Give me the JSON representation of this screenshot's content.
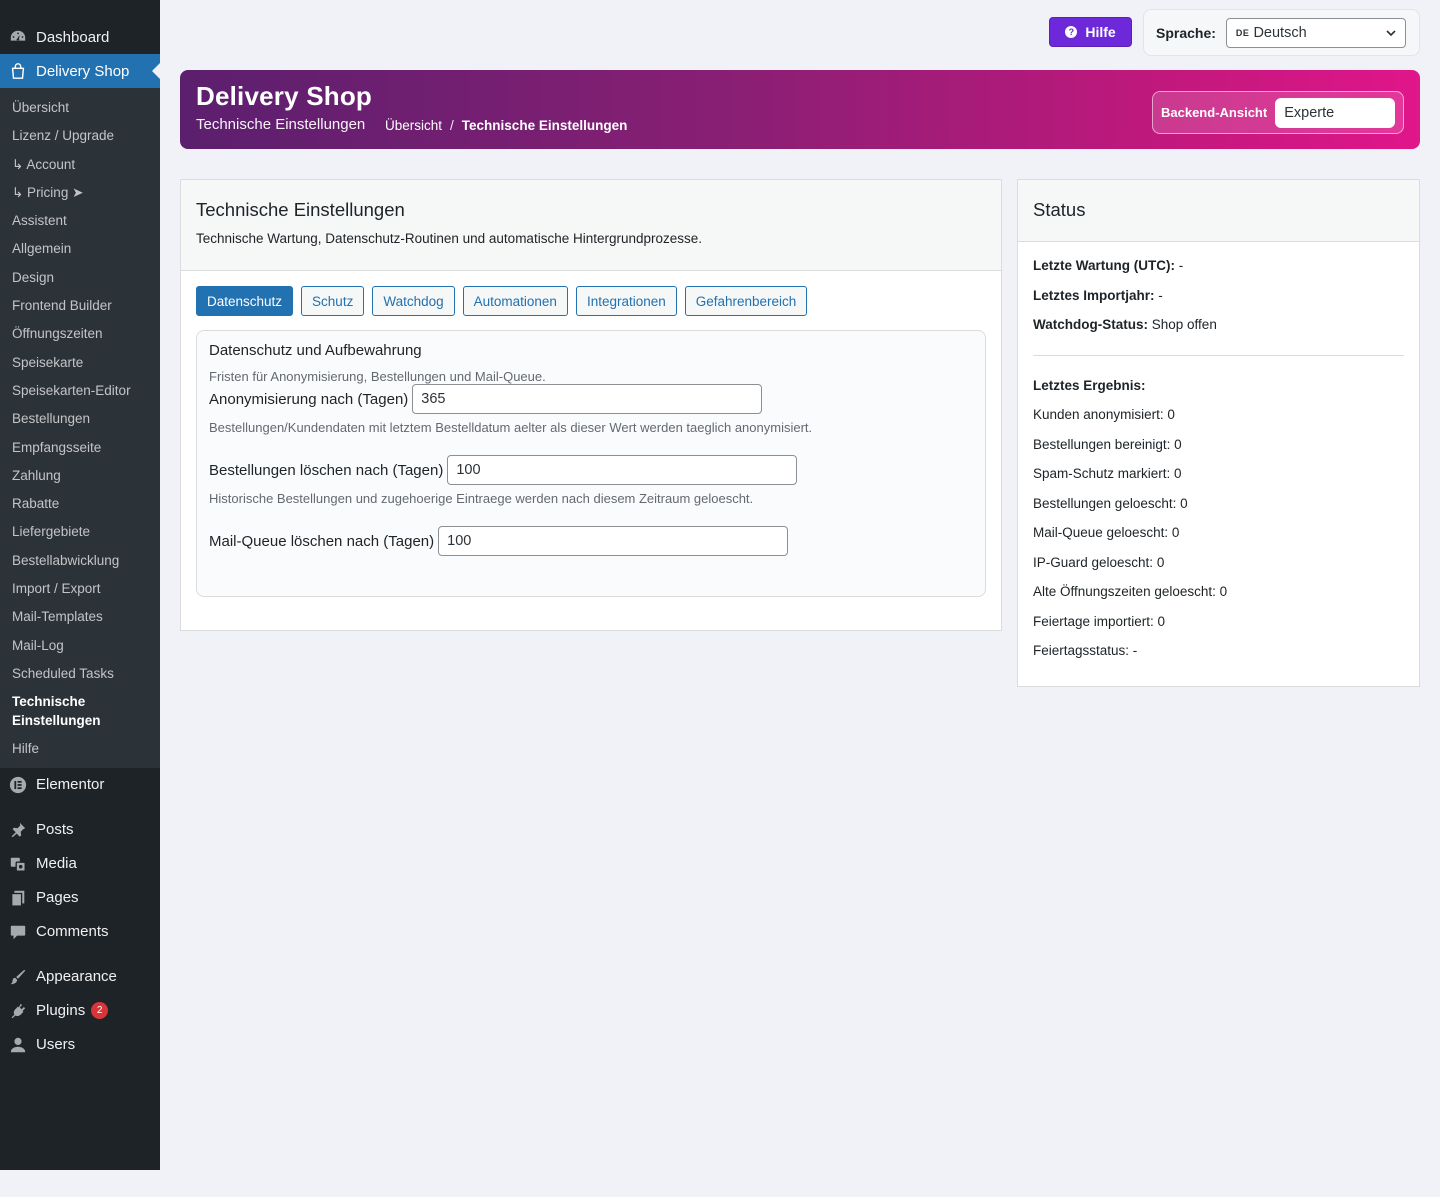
{
  "sidebar": {
    "dashboard": "Dashboard",
    "delivery_shop": "Delivery Shop",
    "submenu": [
      "Übersicht",
      "Lizenz / Upgrade",
      "↳ Account",
      "↳ Pricing ➤",
      "Assistent",
      "Allgemein",
      "Design",
      "Frontend Builder",
      "Öffnungszeiten",
      "Speisekarte",
      "Speisekarten-Editor",
      "Bestellungen",
      "Empfangsseite",
      "Zahlung",
      "Rabatte",
      "Liefergebiete",
      "Bestellabwicklung",
      "Import / Export",
      "Mail-Templates",
      "Mail-Log",
      "Scheduled Tasks",
      "Technische Einstellungen",
      "Hilfe"
    ],
    "elementor": "Elementor",
    "posts": "Posts",
    "media": "Media",
    "pages": "Pages",
    "comments": "Comments",
    "appearance": "Appearance",
    "plugins": "Plugins",
    "plugins_badge": "2",
    "users": "Users"
  },
  "topbar": {
    "help_label": "Hilfe",
    "language_label": "Sprache:",
    "language_flag": "DE",
    "language_value": "Deutsch"
  },
  "banner": {
    "title": "Delivery Shop",
    "subtitle": "Technische Einstellungen",
    "breadcrumb_root": "Übersicht",
    "breadcrumb_sep": "/",
    "breadcrumb_current": "Technische Einstellungen",
    "view_label": "Backend-Ansicht",
    "view_value": "Experte"
  },
  "main": {
    "title": "Technische Einstellungen",
    "description": "Technische Wartung, Datenschutz-Routinen und automatische Hintergrundprozesse.",
    "tabs": [
      "Datenschutz",
      "Schutz",
      "Watchdog",
      "Automationen",
      "Integrationen",
      "Gefahrenbereich"
    ],
    "active_tab": "Datenschutz",
    "section": {
      "title": "Datenschutz und Aufbewahrung",
      "description": "Fristen für Anonymisierung, Bestellungen und Mail-Queue.",
      "fields": [
        {
          "label": "Anonymisierung nach (Tagen)",
          "value": "365",
          "hint": "Bestellungen/Kundendaten mit letztem Bestelldatum aelter als dieser Wert werden taeglich anonymisiert."
        },
        {
          "label": "Bestellungen löschen nach (Tagen)",
          "value": "100",
          "hint": "Historische Bestellungen und zugehoerige Eintraege werden nach diesem Zeitraum geloescht."
        },
        {
          "label": "Mail-Queue löschen nach (Tagen)",
          "value": "100",
          "hint": ""
        }
      ]
    }
  },
  "status": {
    "title": "Status",
    "last_maintenance_label": "Letzte Wartung (UTC):",
    "last_maintenance_value": "-",
    "last_import_year_label": "Letztes Importjahr:",
    "last_import_year_value": "-",
    "watchdog_label": "Watchdog-Status:",
    "watchdog_value": "Shop offen",
    "last_result_label": "Letztes Ergebnis:",
    "results": [
      "Kunden anonymisiert: 0",
      "Bestellungen bereinigt: 0",
      "Spam-Schutz markiert: 0",
      "Bestellungen geloescht: 0",
      "Mail-Queue geloescht: 0",
      "IP-Guard geloescht: 0",
      "Alte Öffnungszeiten geloescht: 0",
      "Feiertage importiert: 0",
      "Feiertagsstatus: -"
    ]
  },
  "colors": {
    "sidebar_bg": "#1d2327",
    "accent": "#2271b1",
    "help_button": "#6d28d9",
    "banner_start": "#5b1f6e",
    "banner_end": "#e0168a"
  }
}
